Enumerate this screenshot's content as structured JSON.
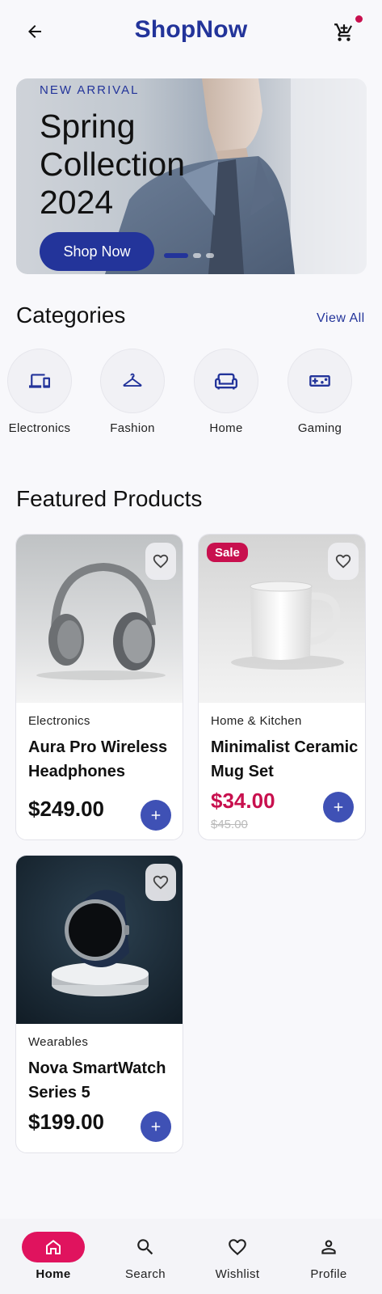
{
  "header": {
    "title": "ShopNow",
    "back_icon": "arrow-left-icon",
    "cart_icon": "cart-icon",
    "cart_has_notification": true
  },
  "hero": {
    "eyebrow": "NEW ARRIVAL",
    "title": "Spring Collection 2024",
    "cta_label": "Shop Now",
    "slides": 3,
    "active_slide": 1
  },
  "categories": {
    "title": "Categories",
    "view_all_label": "View All",
    "items": [
      {
        "label": "Electronics",
        "icon": "devices-icon"
      },
      {
        "label": "Fashion",
        "icon": "hanger-icon"
      },
      {
        "label": "Home",
        "icon": "sofa-icon"
      },
      {
        "label": "Gaming",
        "icon": "gamepad-icon"
      }
    ]
  },
  "featured": {
    "title": "Featured Products",
    "products": [
      {
        "category": "Electronics",
        "name": "Aura Pro Wireless Headphones",
        "price": "$249.00"
      },
      {
        "category": "Home & Kitchen",
        "name": "Minimalist Ceramic Mug Set",
        "price": "$34.00",
        "old_price": "$45.00",
        "badge": "Sale"
      },
      {
        "category": "Wearables",
        "name": "Nova SmartWatch Series 5",
        "price": "$199.00"
      }
    ]
  },
  "bottom_nav": {
    "items": [
      {
        "label": "Home",
        "icon": "home-icon",
        "active": true
      },
      {
        "label": "Search",
        "icon": "search-icon",
        "active": false
      },
      {
        "label": "Wishlist",
        "icon": "heart-icon",
        "active": false
      },
      {
        "label": "Profile",
        "icon": "person-icon",
        "active": false
      }
    ]
  },
  "colors": {
    "brand": "#23349a",
    "accent": "#e0135e",
    "sale": "#c8104e",
    "add_button": "#3f51b5",
    "background": "#f8f8fb"
  }
}
